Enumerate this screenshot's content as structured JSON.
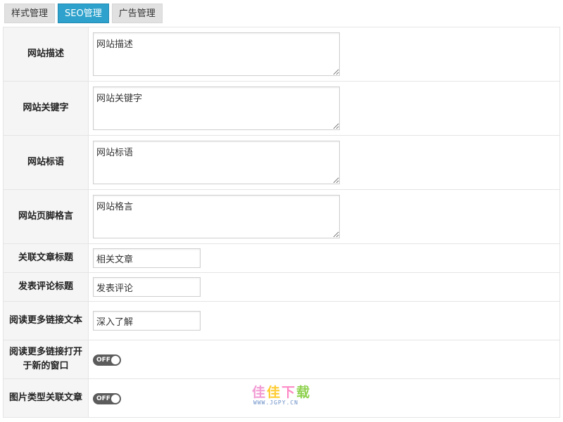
{
  "tabs": [
    {
      "label": "样式管理",
      "active": false
    },
    {
      "label": "SEO管理",
      "active": true
    },
    {
      "label": "广告管理",
      "active": false
    }
  ],
  "fields": {
    "site_description": {
      "label": "网站描述",
      "value": "网站描述"
    },
    "site_keywords": {
      "label": "网站关键字",
      "value": "网站关键字"
    },
    "site_slogan": {
      "label": "网站标语",
      "value": "网站标语"
    },
    "footer_motto": {
      "label": "网站页脚格言",
      "value": "网站格言"
    },
    "related_title": {
      "label": "关联文章标题",
      "value": "相关文章"
    },
    "comment_title": {
      "label": "发表评论标题",
      "value": "发表评论"
    },
    "read_more_text": {
      "label": "阅读更多链接文本",
      "value": "深入了解"
    },
    "read_more_new_window": {
      "label": "阅读更多链接打开于新的窗口",
      "state": "OFF"
    },
    "image_type_related": {
      "label": "图片类型关联文章",
      "state": "OFF"
    }
  },
  "watermark": {
    "logo": "佳佳下载",
    "url": "WWW.JGPY.CN"
  },
  "colors": {
    "accent": "#2ea2cc",
    "toggle_off": "#5c5c5c",
    "header_bg": "#f5f5f5"
  },
  "icons": {
    "resize_handle": "textarea-resize-grip-icon"
  }
}
